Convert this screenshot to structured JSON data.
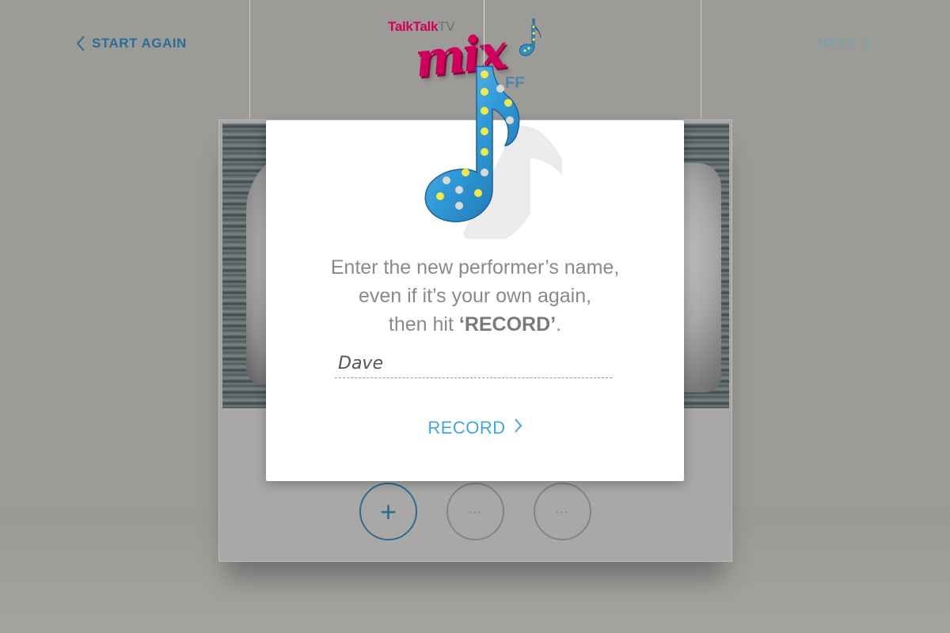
{
  "nav": {
    "start_again_label": "START AGAIN",
    "next_label": "NEXT"
  },
  "logo": {
    "brand": "TalkTalk",
    "brand_suffix": "TV",
    "word": "mix",
    "sub": "FF"
  },
  "dialog": {
    "line1": "Enter the new performer’s name,",
    "line2": "even if it’s your own again,",
    "line3_prefix": "then hit ",
    "line3_strong": "‘RECORD’",
    "line3_suffix": ".",
    "name_value": "Dave",
    "record_label": "RECORD"
  },
  "controls": {
    "add_symbol": "+",
    "more_symbol": "···"
  },
  "icons": {
    "nav_back": "chevron-left-icon",
    "nav_next": "chevron-right-icon",
    "record": "chevron-right-icon",
    "decoration": "music-note-icon"
  },
  "colors": {
    "accent_blue": "#3ea6df",
    "nav_blue": "#2b6d95",
    "brand_pink": "#d1005d",
    "note_blue": "#2f9ad8",
    "note_bulb": "#f2e84a"
  }
}
